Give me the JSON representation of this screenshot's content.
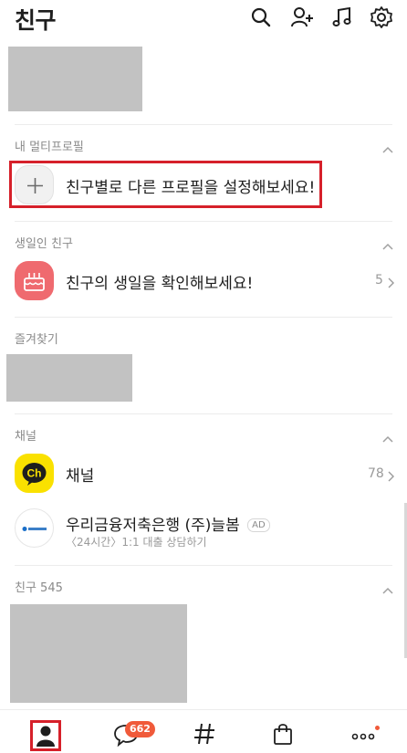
{
  "header": {
    "title": "친구"
  },
  "sections": {
    "multiprofile": {
      "title": "내 멀티프로필",
      "row_text": "친구별로 다른 프로필을 설정해보세요!"
    },
    "birthday": {
      "title": "생일인 친구",
      "row_text": "친구의 생일을 확인해보세요!",
      "count": "5"
    },
    "favorites": {
      "title": "즐겨찾기"
    },
    "channel": {
      "title": "채널",
      "channel_row": {
        "text": "채널",
        "count": "78",
        "icon_text": "Ch"
      },
      "ad_row": {
        "name": "우리금융저축은행 (주)늘봄",
        "ad_badge": "AD",
        "sub": "〈24시간〉1:1 대출 상담하기"
      }
    },
    "friends": {
      "title": "친구 545"
    }
  },
  "bottom_nav": {
    "chat_badge": "662"
  },
  "colors": {
    "highlight": "#d6202a",
    "badge": "#f05a3a",
    "channel_yellow": "#fae100",
    "cake": "#ef6a6f"
  }
}
